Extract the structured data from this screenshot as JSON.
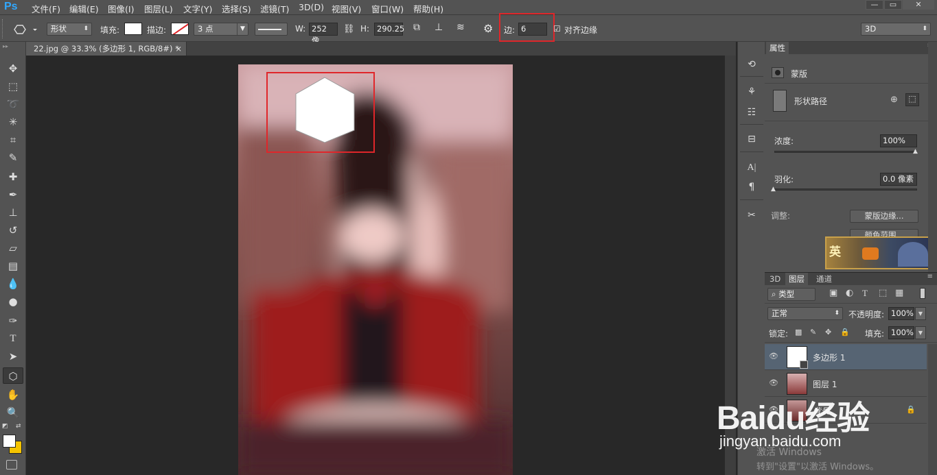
{
  "app": {
    "logo": "Ps"
  },
  "menu": [
    "文件(F)",
    "编辑(E)",
    "图像(I)",
    "图层(L)",
    "文字(Y)",
    "选择(S)",
    "滤镜(T)",
    "3D(D)",
    "视图(V)",
    "窗口(W)",
    "帮助(H)"
  ],
  "window_controls": {
    "minimize": "—",
    "restore": "▭",
    "close": "✕"
  },
  "options": {
    "mode": "形状",
    "fill_label": "填充:",
    "stroke_label": "描边:",
    "stroke_width": "3 点",
    "w_label": "W:",
    "w_value": "252 像",
    "h_label": "H:",
    "h_value": "290.25",
    "sides_label": "边:",
    "sides_value": "6",
    "align_edges": "对齐边缘",
    "workspace": "3D",
    "fill_color": "#ffffff"
  },
  "document": {
    "tab_title": "22.jpg @ 33.3% (多边形 1, RGB/8#) *",
    "close": "×"
  },
  "properties": {
    "tabs": [
      "属性"
    ],
    "mask_label": "蒙版",
    "shape_path_label": "形状路径",
    "density_label": "浓度:",
    "density_value": "100%",
    "density_level": 1.0,
    "feather_label": "羽化:",
    "feather_value": "0.0 像素",
    "feather_level": 0.0,
    "adjust_label": "调整:",
    "mask_edge_button": "蒙版边缘...",
    "color_range_button": "颜色范围...",
    "ad_badge": "英"
  },
  "layers_panel": {
    "tabs": [
      "3D",
      "图层",
      "通道"
    ],
    "filter_type": "类型",
    "blend_mode": "正常",
    "opacity_label": "不透明度:",
    "opacity_value": "100%",
    "lock_label": "锁定:",
    "fill_label": "填充:",
    "fill_value": "100%",
    "layers": [
      {
        "name": "多边形 1",
        "selected": true
      },
      {
        "name": "图层 1",
        "selected": false
      },
      {
        "name": "背景",
        "selected": false
      }
    ]
  },
  "watermark": {
    "brand": "Baidu经验",
    "url": "jingyan.baidu.com",
    "activate_title": "激活 Windows",
    "activate_sub": "转到\"设置\"以激活 Windows。"
  },
  "colors": {
    "accent_red": "#e0262a",
    "ps_blue": "#31a8ff",
    "selected_layer": "#566473",
    "background_swatch": "#f5c400"
  }
}
